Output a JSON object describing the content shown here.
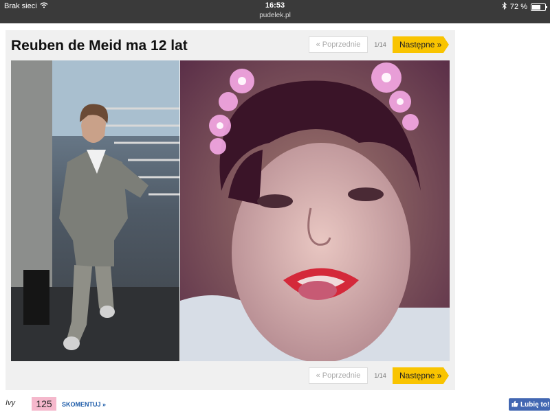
{
  "status_bar": {
    "carrier": "Brak sieci",
    "time": "16:53",
    "url": "pudelek.pl",
    "battery": "72 %",
    "battery_level": 0.72
  },
  "gallery": {
    "title": "Reuben de Meid ma 12 lat",
    "prev_label": "« Poprzednie",
    "next_label": "Następne »",
    "counter": "1/14"
  },
  "footer": {
    "author": "Ivy",
    "comment_count": "125",
    "comment_link": "SKOMENTUJ »",
    "like_label": "Lubię to!"
  },
  "colors": {
    "accent_yellow": "#f9c400",
    "status_bar": "#3a3a3a",
    "comment_badge": "#f5b8cc",
    "facebook_blue": "#4267b2"
  }
}
